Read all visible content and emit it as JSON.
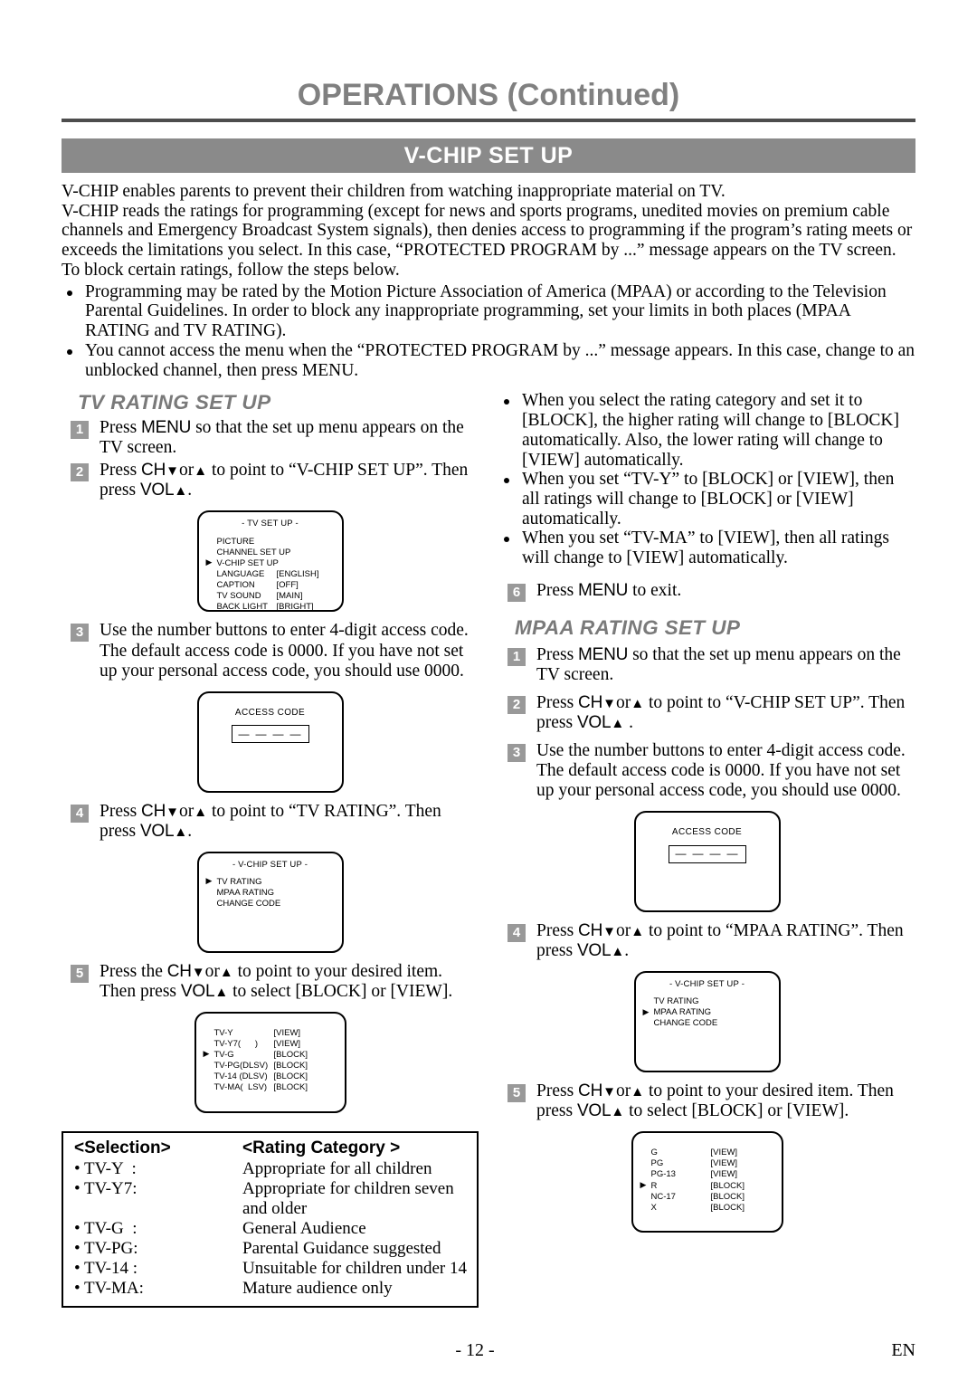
{
  "header": {
    "title": "OPERATIONS (Continued)",
    "banner": "V-CHIP SET UP"
  },
  "intro": {
    "lines": [
      "V-CHIP enables parents to prevent their children from watching inappropriate material on TV.",
      "V-CHIP reads the ratings for programming (except for news and sports programs, unedited movies on premium cable channels and Emergency Broadcast System signals), then denies access to programming if the program’s rating meets or exceeds the limitations you select. In this case, “PROTECTED PROGRAM by ...” message appears on the TV screen.",
      "To block certain ratings, follow the steps below."
    ],
    "bullets": [
      "Programming may be rated by the Motion Picture Association of America (MPAA) or according to the Television Parental Guidelines. In order to block any inappropriate programming, set your limits in both places (MPAA RATING and TV RATING).",
      "You cannot access the menu when the “PROTECTED PROGRAM by ...” message appears. In this case, change to an unblocked channel, then press MENU."
    ]
  },
  "tv_rating": {
    "heading": "TV RATING SET UP",
    "step1_num": "1",
    "step1_a": "Press ",
    "step1_key": "MENU",
    "step1_b": " so that the set up menu appears on the TV screen.",
    "step2_num": "2",
    "step2_a": "Press ",
    "step2_key_ch": "CH",
    "step2_down": "▼",
    "step2_or": "or",
    "step2_up": "▲",
    "step2_b": " to point to “V-CHIP SET UP”. Then press ",
    "step2_key_vol": "VOL",
    "step2_up2": "▲",
    "step2_c": ".",
    "step3_num": "3",
    "step3_text": "Use the number buttons to enter 4-digit access code. The default access code is 0000. If you have not set up your personal access code, you should use 0000.",
    "step4_num": "4",
    "step4_a": "Press ",
    "step4_b": " to point to “TV RATING”. Then press ",
    "step4_c": ".",
    "step5_num": "5",
    "step5_a": "Press the ",
    "step5_b": " to point to your desired item. Then press ",
    "step5_c": " to select [BLOCK] or [VIEW]."
  },
  "osd_tv_setup": {
    "title": "- TV SET UP -",
    "rows": [
      {
        "label": "PICTURE",
        "value": "",
        "selected": false
      },
      {
        "label": "CHANNEL SET UP",
        "value": "",
        "selected": false
      },
      {
        "label": "V-CHIP SET UP",
        "value": "",
        "selected": true
      },
      {
        "label": "LANGUAGE",
        "value": "[ENGLISH]",
        "selected": false
      },
      {
        "label": "CAPTION",
        "value": "[OFF]",
        "selected": false
      },
      {
        "label": "TV SOUND",
        "value": "[MAIN]",
        "selected": false
      },
      {
        "label": "BACK LIGHT",
        "value": "[BRIGHT]",
        "selected": false
      }
    ]
  },
  "osd_access_code": {
    "title": "ACCESS CODE",
    "digits": [
      "—",
      "—",
      "—",
      "—"
    ]
  },
  "osd_vchip_tv": {
    "title": "- V-CHIP SET UP -",
    "rows": [
      {
        "label": "TV RATING",
        "value": "",
        "selected": true
      },
      {
        "label": "MPAA RATING",
        "value": "",
        "selected": false
      },
      {
        "label": "CHANGE CODE",
        "value": "",
        "selected": false
      }
    ]
  },
  "osd_tv_ratings": {
    "title": "",
    "rows": [
      {
        "label": "TV-Y",
        "value": "[VIEW]",
        "selected": false
      },
      {
        "label": "TV-Y7(      )",
        "value": "[VIEW]",
        "selected": false
      },
      {
        "label": "TV-G",
        "value": "[BLOCK]",
        "selected": true
      },
      {
        "label": "TV-PG(DLSV)",
        "value": "[BLOCK]",
        "selected": false
      },
      {
        "label": "TV-14 (DLSV)",
        "value": "[BLOCK]",
        "selected": false
      },
      {
        "label": "TV-MA(  LSV)",
        "value": "[BLOCK]",
        "selected": false
      }
    ]
  },
  "selection_table": {
    "head_col1": "<Selection>",
    "head_col2": "<Rating Category >",
    "rows": [
      {
        "sel": "• TV-Y  :",
        "cat": "Appropriate for all children"
      },
      {
        "sel": "• TV-Y7:",
        "cat": "Appropriate for children seven"
      },
      {
        "sel": "",
        "cat": "and older"
      },
      {
        "sel": "• TV-G  :",
        "cat": "General Audience"
      },
      {
        "sel": "• TV-PG:",
        "cat": "Parental Guidance suggested"
      },
      {
        "sel": "• TV-14 :",
        "cat": "Unsuitable for children under 14"
      },
      {
        "sel": "• TV-MA:",
        "cat": "Mature audience only"
      }
    ]
  },
  "right_notes": [
    "When you select the rating category and set it to [BLOCK], the higher rating will change to [BLOCK] automatically. Also, the lower rating will change to [VIEW] automatically.",
    "When you set “TV-Y” to [BLOCK] or [VIEW], then all ratings will change to [BLOCK] or [VIEW] automatically.",
    "When you set “TV-MA” to [VIEW], then all ratings will change to [VIEW] automatically."
  ],
  "step6": {
    "num": "6",
    "a": "Press ",
    "key": "MENU",
    "b": " to exit."
  },
  "mpaa_rating": {
    "heading": "MPAA RATING SET UP",
    "step1_num": "1",
    "step1_a": "Press ",
    "step1_key": "MENU",
    "step1_b": " so that the set up menu appears on the TV screen.",
    "step2_num": "2",
    "step2_a": "Press ",
    "step2_b": " to point to “V-CHIP SET UP”. Then press ",
    "step2_c": " .",
    "step3_num": "3",
    "step3_text": "Use the number buttons to enter 4-digit access code. The default access code is 0000. If you have not set up your personal access code, you should use 0000.",
    "step4_num": "4",
    "step4_a": "Press ",
    "step4_b": " to point to “MPAA RATING”. Then press ",
    "step4_c": ".",
    "step5_num": "5",
    "step5_a": "Press ",
    "step5_b": " to point to your desired item. Then press ",
    "step5_c": " to select [BLOCK] or [VIEW]."
  },
  "osd_vchip_mpaa": {
    "title": "- V-CHIP SET UP -",
    "rows": [
      {
        "label": "TV RATING",
        "value": "",
        "selected": false
      },
      {
        "label": "MPAA RATING",
        "value": "",
        "selected": true
      },
      {
        "label": "CHANGE CODE",
        "value": "",
        "selected": false
      }
    ]
  },
  "osd_mpaa_ratings": {
    "title": "",
    "rows": [
      {
        "label": "G",
        "value": "[VIEW]",
        "selected": false
      },
      {
        "label": "PG",
        "value": "[VIEW]",
        "selected": false
      },
      {
        "label": "PG-13",
        "value": "[VIEW]",
        "selected": false
      },
      {
        "label": "R",
        "value": "[BLOCK]",
        "selected": true
      },
      {
        "label": "NC-17",
        "value": "[BLOCK]",
        "selected": false
      },
      {
        "label": "X",
        "value": "[BLOCK]",
        "selected": false
      }
    ]
  },
  "keys": {
    "menu": "MENU",
    "ch": "CH",
    "vol": "VOL",
    "down": "▼",
    "up": "▲",
    "or": "or"
  },
  "footer": {
    "page": "- 12 -",
    "lang": "EN"
  },
  "colors": {
    "banner_bg": "#8a8a8a",
    "title_gray": "#808080",
    "subheading_gray": "#7a7a7a",
    "step_num_bg": "#999999",
    "rule": "#4d4d4d"
  }
}
